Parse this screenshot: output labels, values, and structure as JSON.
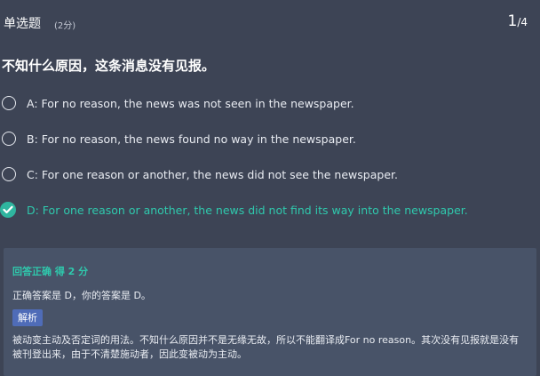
{
  "header": {
    "question_type": "单选题",
    "score": "(2分)",
    "progress_current": "1",
    "progress_separator": "/",
    "progress_total": "4"
  },
  "question": {
    "stem": "不知什么原因，这条消息没有见报。",
    "options": [
      {
        "label": "A: For no reason, the news was not seen in the newspaper.",
        "selected": false
      },
      {
        "label": "B: For no reason, the news found no way in the newspaper.",
        "selected": false
      },
      {
        "label": "C: For one reason or another, the news did not see the newspaper.",
        "selected": false
      },
      {
        "label": "D: For one reason or another, the news did not find its way into the newspaper.",
        "selected": true
      }
    ]
  },
  "feedback": {
    "result": "回答正确 得 2 分",
    "answer_text": "正确答案是 D，你的答案是 D。",
    "explanation_tag": "解析",
    "explanation": "被动变主动及否定词的用法。不知什么原因并不是无缘无故，所以不能翻译成For no reason。其次没有见报就是没有被刊登出来，由于不清楚施动者，因此变被动为主动。"
  },
  "colors": {
    "background": "#3d4455",
    "panel": "#485368",
    "correct": "#2fc9ad",
    "tag": "#4f6cb8"
  }
}
